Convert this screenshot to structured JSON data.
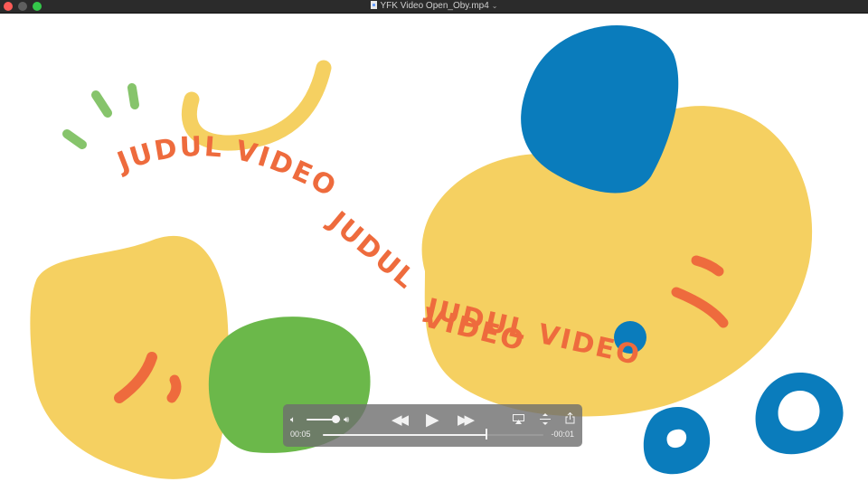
{
  "window": {
    "title": "YFK Video Open_Oby.mp4",
    "file_icon": "video-document-icon",
    "title_chevron_icon": "chevron-down-icon"
  },
  "video": {
    "texts": [
      "JUDUL VIDEO",
      "JUDUL",
      "VIDEO",
      "JUDUL VIDEO"
    ],
    "colors": {
      "yellow": "#f5d061",
      "blue": "#0a7cbc",
      "green": "#6bb84a",
      "orange": "#ee6b3d",
      "light_green": "#86c46b"
    }
  },
  "controls": {
    "current_time": "00:05",
    "remaining_time": "-00:01",
    "progress": 0.74,
    "volume": 0.85,
    "icons": {
      "volume_low": "speaker-low-icon",
      "volume_high": "speaker-high-icon",
      "rewind": "rewind-icon",
      "play": "play-icon",
      "fast_forward": "fast-forward-icon",
      "airplay": "airplay-icon",
      "resize": "resize-icon",
      "share": "share-icon"
    }
  }
}
